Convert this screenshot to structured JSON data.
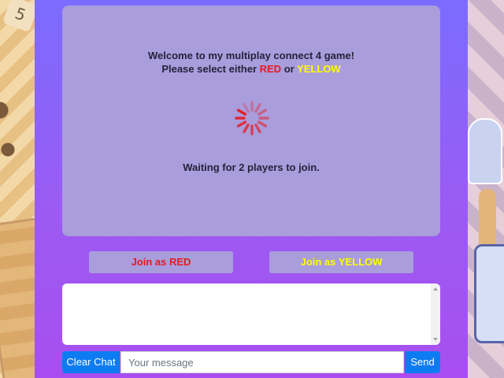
{
  "status": {
    "welcome_line": "Welcome to my multiplay connect 4 game!",
    "select_prefix": "Please select either ",
    "red_word": "RED",
    "or_word": " or ",
    "yellow_word": "YELLOW",
    "waiting": "Waiting for 2 players to join."
  },
  "buttons": {
    "join_red": "Join as RED",
    "join_yellow": "Join as YELLOW"
  },
  "chat": {
    "clear_label": "Clear Chat",
    "input_placeholder": "Your message",
    "input_value": "",
    "send_label": "Send"
  },
  "background": {
    "dice_face": "5"
  },
  "colors": {
    "red": "#e8191f",
    "yellow": "#ffff00",
    "accent_blue": "#0d7cf2",
    "card": "#a99ddc"
  },
  "icons": {
    "spinner": "loading-spinner-icon"
  }
}
